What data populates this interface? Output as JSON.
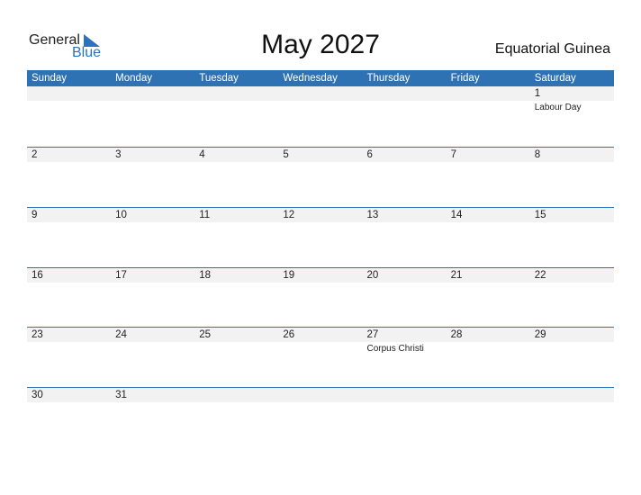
{
  "logo": {
    "general": "General",
    "blue": "Blue"
  },
  "title": "May 2027",
  "country": "Equatorial Guinea",
  "days": [
    "Sunday",
    "Monday",
    "Tuesday",
    "Wednesday",
    "Thursday",
    "Friday",
    "Saturday"
  ],
  "weeks": [
    [
      {
        "d": "",
        "h": ""
      },
      {
        "d": "",
        "h": ""
      },
      {
        "d": "",
        "h": ""
      },
      {
        "d": "",
        "h": ""
      },
      {
        "d": "",
        "h": ""
      },
      {
        "d": "",
        "h": ""
      },
      {
        "d": "1",
        "h": "Labour Day"
      }
    ],
    [
      {
        "d": "2",
        "h": ""
      },
      {
        "d": "3",
        "h": ""
      },
      {
        "d": "4",
        "h": ""
      },
      {
        "d": "5",
        "h": ""
      },
      {
        "d": "6",
        "h": ""
      },
      {
        "d": "7",
        "h": ""
      },
      {
        "d": "8",
        "h": ""
      }
    ],
    [
      {
        "d": "9",
        "h": ""
      },
      {
        "d": "10",
        "h": ""
      },
      {
        "d": "11",
        "h": ""
      },
      {
        "d": "12",
        "h": ""
      },
      {
        "d": "13",
        "h": ""
      },
      {
        "d": "14",
        "h": ""
      },
      {
        "d": "15",
        "h": ""
      }
    ],
    [
      {
        "d": "16",
        "h": ""
      },
      {
        "d": "17",
        "h": ""
      },
      {
        "d": "18",
        "h": ""
      },
      {
        "d": "19",
        "h": ""
      },
      {
        "d": "20",
        "h": ""
      },
      {
        "d": "21",
        "h": ""
      },
      {
        "d": "22",
        "h": ""
      }
    ],
    [
      {
        "d": "23",
        "h": ""
      },
      {
        "d": "24",
        "h": ""
      },
      {
        "d": "25",
        "h": ""
      },
      {
        "d": "26",
        "h": ""
      },
      {
        "d": "27",
        "h": "Corpus Christi"
      },
      {
        "d": "28",
        "h": ""
      },
      {
        "d": "29",
        "h": ""
      }
    ],
    [
      {
        "d": "30",
        "h": ""
      },
      {
        "d": "31",
        "h": ""
      },
      {
        "d": "",
        "h": ""
      },
      {
        "d": "",
        "h": ""
      },
      {
        "d": "",
        "h": ""
      },
      {
        "d": "",
        "h": ""
      },
      {
        "d": "",
        "h": ""
      }
    ]
  ]
}
